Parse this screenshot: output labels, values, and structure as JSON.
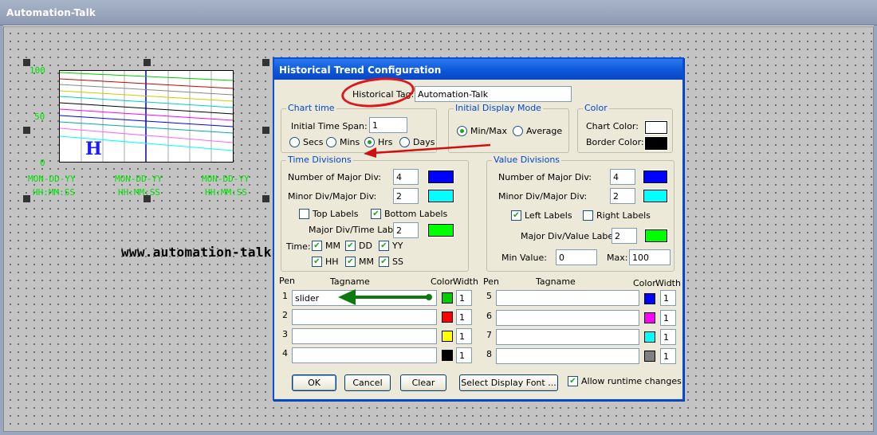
{
  "window": {
    "title": "Automation-Talk"
  },
  "canvas": {
    "watermark": "www.automation-talk.info",
    "trend": {
      "y_labels": [
        "100",
        "50",
        "0"
      ],
      "x_labels": [
        {
          "date": "MON-DD-YY",
          "time": "HH:MM:SS"
        },
        {
          "date": "MON-DD-YY",
          "time": "HH:MM:SS"
        },
        {
          "date": "MON-DD-YY",
          "time": "HH:MM:SS"
        }
      ],
      "marker": "H"
    }
  },
  "dialog": {
    "title": "Historical Trend Configuration",
    "historical_tag_label": "Historical Tag:",
    "historical_tag_value": "Automation-Talk",
    "chart_time": {
      "title": "Chart time",
      "span_label": "Initial Time Span:",
      "span_value": "1",
      "options": [
        {
          "label": "Secs",
          "selected": false
        },
        {
          "label": "Mins",
          "selected": false
        },
        {
          "label": "Hrs",
          "selected": true
        },
        {
          "label": "Days",
          "selected": false
        }
      ]
    },
    "display_mode": {
      "title": "Initial Display Mode",
      "options": [
        {
          "label": "Min/Max",
          "selected": true
        },
        {
          "label": "Average",
          "selected": false
        }
      ]
    },
    "color": {
      "title": "Color",
      "chart_color_label": "Chart Color:",
      "chart_color": "#ffffff",
      "border_color_label": "Border Color:",
      "border_color": "#000000"
    },
    "time_divisions": {
      "title": "Time Divisions",
      "major_label": "Number of Major Div:",
      "major_value": "4",
      "major_color": "#0000ff",
      "minor_label": "Minor Div/Major Div:",
      "minor_value": "2",
      "minor_color": "#00ffff",
      "top_labels": {
        "label": "Top Labels",
        "checked": false
      },
      "bottom_labels": {
        "label": "Bottom Labels",
        "checked": true
      },
      "major_time_label": "Major Div/Time Label:",
      "major_time_value": "2",
      "major_time_color": "#00ff00",
      "time_label": "Time:",
      "time_fields": [
        {
          "label": "MM",
          "checked": true
        },
        {
          "label": "DD",
          "checked": true
        },
        {
          "label": "YY",
          "checked": true
        },
        {
          "label": "HH",
          "checked": true
        },
        {
          "label": "MM",
          "checked": true
        },
        {
          "label": "SS",
          "checked": true
        }
      ]
    },
    "value_divisions": {
      "title": "Value Divisions",
      "major_label": "Number of Major Div:",
      "major_value": "4",
      "major_color": "#0000ff",
      "minor_label": "Minor Div/Major Div:",
      "minor_value": "2",
      "minor_color": "#00ffff",
      "left_labels": {
        "label": "Left Labels",
        "checked": true
      },
      "right_labels": {
        "label": "Right Labels",
        "checked": false
      },
      "major_value_label": "Major Div/Value Label:",
      "major_value_value": "2",
      "major_value_color": "#00ff00",
      "min_label": "Min Value:",
      "min_value": "0",
      "max_label": "Max:",
      "max_value": "100"
    },
    "pens": {
      "headers": {
        "pen": "Pen",
        "tagname": "Tagname",
        "color": "Color",
        "width": "Width"
      },
      "left": [
        {
          "num": "1",
          "tag": "slider",
          "color": "#00cc00",
          "width": "1"
        },
        {
          "num": "2",
          "tag": "",
          "color": "#ff0000",
          "width": "1"
        },
        {
          "num": "3",
          "tag": "",
          "color": "#ffff00",
          "width": "1"
        },
        {
          "num": "4",
          "tag": "",
          "color": "#000000",
          "width": "1"
        }
      ],
      "right": [
        {
          "num": "5",
          "tag": "",
          "color": "#0000ff",
          "width": "1"
        },
        {
          "num": "6",
          "tag": "",
          "color": "#ff00ff",
          "width": "1"
        },
        {
          "num": "7",
          "tag": "",
          "color": "#00ffff",
          "width": "1"
        },
        {
          "num": "8",
          "tag": "",
          "color": "#808080",
          "width": "1"
        }
      ]
    },
    "buttons": {
      "ok": "OK",
      "cancel": "Cancel",
      "clear": "Clear",
      "font": "Select Display Font ...",
      "runtime": {
        "label": "Allow runtime changes",
        "checked": true
      }
    }
  }
}
